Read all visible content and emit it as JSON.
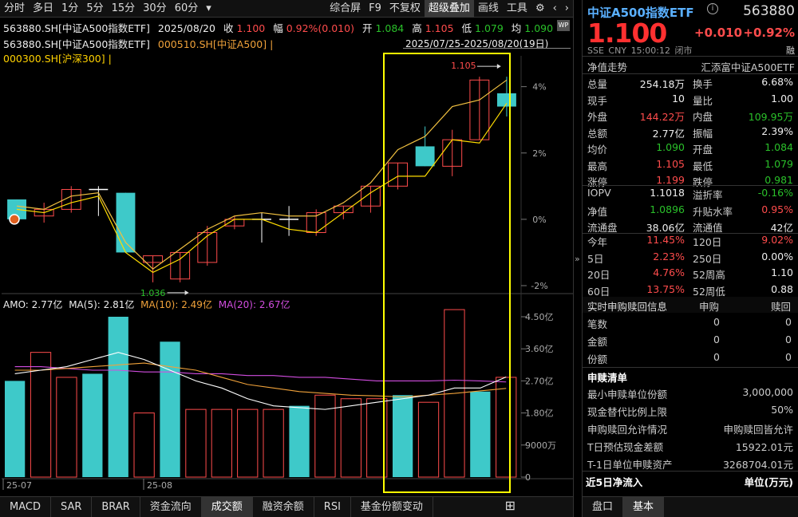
{
  "toolbar": {
    "left": [
      "分时",
      "多日",
      "1分",
      "5分",
      "15分",
      "30分",
      "60分",
      "▾"
    ],
    "right": [
      "综合屏",
      "F9",
      "不复权",
      "超级叠加",
      "画线",
      "工具"
    ],
    "active": "超级叠加"
  },
  "info1": {
    "code": "563880.SH[中证A500指数ETF]",
    "date": "2025/08/20",
    "close_label": "收",
    "close": "1.100",
    "chg_label": "幅",
    "chg": "0.92%(0.010)",
    "open_label": "开",
    "open": "1.084",
    "high_label": "高",
    "high": "1.105",
    "low_label": "低",
    "low": "1.079",
    "avg_label": "均",
    "avg": "1.090",
    "badge": "WP"
  },
  "info2": {
    "main": "563880.SH[中证A500指数ETF]",
    "overlay1": "000510.SH[中证A500]",
    "range": "2025/07/25-2025/08/20(19日)"
  },
  "info3": {
    "overlay2": "000300.SH[沪深300]"
  },
  "price_axis": [
    "4%",
    "2%",
    "0%",
    "-2%"
  ],
  "annotations": {
    "high": "1.105",
    "low": "1.036"
  },
  "vol_info": {
    "amo": "AMO: 2.77亿",
    "ma5": "MA(5): 2.81亿",
    "ma10": "MA(10): 2.49亿",
    "ma20": "MA(20): 2.67亿"
  },
  "vol_axis": [
    "4.50亿",
    "3.60亿",
    "2.70亿",
    "1.80亿",
    "9000万",
    "0"
  ],
  "date_axis": [
    "25-07",
    "25-08"
  ],
  "bottom_tabs": [
    "MACD",
    "SAR",
    "BRAR",
    "资金流向",
    "成交额",
    "融资余额",
    "RSI",
    "基金份额变动"
  ],
  "bottom_active": "成交额",
  "chart_data": {
    "type": "candlestick",
    "days": 19,
    "close_pct": [
      0.0,
      0.3,
      0.6,
      0.3,
      -1.2,
      -1.7,
      -1.3,
      -0.6,
      0.0,
      0.1,
      0.0,
      -0.3,
      0.3,
      0.8,
      1.6,
      2.1,
      3.4,
      3.6,
      3.6
    ],
    "ohlc_pct": [
      [
        0.6,
        0.6,
        0.0,
        0.0
      ],
      [
        0.1,
        0.5,
        -0.1,
        0.3
      ],
      [
        0.3,
        1.0,
        0.2,
        0.9
      ],
      [
        0.9,
        1.0,
        0.1,
        0.9
      ],
      [
        0.8,
        0.8,
        -1.0,
        -1.0
      ],
      [
        -1.3,
        -1.1,
        -1.9,
        -1.1
      ],
      [
        -1.8,
        -1.0,
        -1.9,
        -1.0
      ],
      [
        -1.3,
        -0.2,
        -1.4,
        -0.4
      ],
      [
        -0.2,
        0.1,
        -0.3,
        0.0
      ],
      [
        0.0,
        0.2,
        -0.7,
        0.0
      ],
      [
        0.0,
        0.4,
        -0.5,
        0.0
      ],
      [
        -0.4,
        0.3,
        -0.5,
        0.2
      ],
      [
        0.2,
        0.4,
        0.0,
        0.4
      ],
      [
        0.4,
        1.0,
        0.2,
        1.0
      ],
      [
        1.0,
        1.7,
        0.9,
        1.7
      ],
      [
        2.2,
        2.8,
        1.6,
        1.6
      ],
      [
        1.6,
        2.7,
        1.3,
        2.4
      ],
      [
        2.4,
        4.3,
        2.4,
        4.2
      ],
      [
        3.8,
        4.3,
        3.1,
        3.4
      ]
    ],
    "ohlc_overlay_extra": [
      [
        4.2,
        4.4,
        2.8,
        2.9
      ]
    ],
    "line_index_a500": [
      0.4,
      0.3,
      0.7,
      0.8,
      -0.7,
      -1.5,
      -0.9,
      -0.3,
      0.1,
      0.2,
      0.1,
      0.1,
      0.5,
      1.1,
      2.1,
      2.5,
      3.4,
      3.6,
      4.2
    ],
    "line_hs300": [
      0.3,
      0.2,
      0.5,
      0.7,
      -1.0,
      -1.6,
      -1.2,
      -0.5,
      0.0,
      0.0,
      -0.3,
      -0.4,
      0.2,
      0.8,
      1.3,
      1.3,
      2.4,
      2.3,
      3.5
    ],
    "volume_yi": [
      2.7,
      3.5,
      2.8,
      2.9,
      4.5,
      1.8,
      3.8,
      1.9,
      1.9,
      1.9,
      1.9,
      2.0,
      2.3,
      2.2,
      2.2,
      2.3,
      2.1,
      4.7,
      2.4,
      2.8
    ],
    "volume_up": [
      false,
      true,
      true,
      false,
      false,
      true,
      false,
      true,
      true,
      true,
      true,
      false,
      true,
      true,
      true,
      false,
      true,
      true,
      false,
      true
    ],
    "ma5_yi": [
      2.9,
      3.0,
      3.1,
      3.3,
      3.5,
      3.3,
      3.0,
      2.7,
      2.5,
      2.2,
      2.0,
      1.95,
      1.9,
      2.0,
      2.1,
      2.2,
      2.3,
      2.5,
      2.5,
      2.81
    ],
    "ma10_yi": [
      3.0,
      3.0,
      3.05,
      3.1,
      3.15,
      3.2,
      3.1,
      3.0,
      2.8,
      2.6,
      2.5,
      2.4,
      2.35,
      2.3,
      2.28,
      2.25,
      2.3,
      2.35,
      2.42,
      2.49
    ],
    "ma20_yi": [
      3.1,
      3.1,
      3.05,
      3.0,
      3.0,
      2.95,
      2.95,
      2.9,
      2.9,
      2.85,
      2.85,
      2.8,
      2.8,
      2.75,
      2.7,
      2.7,
      2.7,
      2.72,
      2.7,
      2.67
    ],
    "ylim_pct": [
      -2.0,
      4.4
    ],
    "vol_ylim": [
      0,
      4.5
    ]
  },
  "quote": {
    "name": "中证A500指数ETF",
    "code": "563880",
    "price": "1.100",
    "change": "+0.010",
    "change_pct": "+0.92%",
    "meta": [
      "SSE",
      "CNY",
      "15:00:12",
      "闭市"
    ],
    "tag": "融"
  },
  "nav_row": {
    "left": "净值走势",
    "right": "汇添富中证A500ETF"
  },
  "stats": [
    {
      "k1": "总量",
      "v1": "254.18万",
      "c1": "white",
      "k2": "换手",
      "v2": "6.68%",
      "c2": "white"
    },
    {
      "k1": "现手",
      "v1": "10",
      "c1": "white",
      "k2": "量比",
      "v2": "1.00",
      "c2": "white"
    },
    {
      "k1": "外盘",
      "v1": "144.22万",
      "c1": "red",
      "k2": "内盘",
      "v2": "109.95万",
      "c2": "green"
    },
    {
      "k1": "总额",
      "v1": "2.77亿",
      "c1": "white",
      "k2": "振幅",
      "v2": "2.39%",
      "c2": "white"
    },
    {
      "k1": "均价",
      "v1": "1.090",
      "c1": "green",
      "k2": "开盘",
      "v2": "1.084",
      "c2": "green"
    },
    {
      "k1": "最高",
      "v1": "1.105",
      "c1": "red",
      "k2": "最低",
      "v2": "1.079",
      "c2": "green"
    },
    {
      "k1": "涨停",
      "v1": "1.199",
      "c1": "red",
      "k2": "跌停",
      "v2": "0.981",
      "c2": "green"
    }
  ],
  "stats2": [
    {
      "k1": "IOPV",
      "v1": "1.1018",
      "c1": "white",
      "k2": "溢折率",
      "v2": "-0.16%",
      "c2": "green"
    },
    {
      "k1": "净值",
      "v1": "1.0896",
      "c1": "green",
      "k2": "升贴水率",
      "v2": "0.95%",
      "c2": "red"
    },
    {
      "k1": "流通盘",
      "v1": "38.06亿",
      "c1": "white",
      "k2": "流通值",
      "v2": "42亿",
      "c2": "white"
    }
  ],
  "stats3": [
    {
      "k1": "今年",
      "v1": "11.45%",
      "c1": "red",
      "k2": "120日",
      "v2": "9.02%",
      "c2": "red"
    },
    {
      "k1": "5日",
      "v1": "2.23%",
      "c1": "red",
      "k2": "250日",
      "v2": "0.00%",
      "c2": "white"
    },
    {
      "k1": "20日",
      "v1": "4.76%",
      "c1": "red",
      "k2": "52周高",
      "v2": "1.10",
      "c2": "white"
    },
    {
      "k1": "60日",
      "v1": "13.75%",
      "c1": "red",
      "k2": "52周低",
      "v2": "0.88",
      "c2": "white"
    }
  ],
  "realtime": {
    "header": [
      "实时申购赎回信息",
      "申购",
      "赎回"
    ],
    "rows": [
      {
        "k": "笔数",
        "a": "0",
        "b": "0"
      },
      {
        "k": "金额",
        "a": "0",
        "b": "0"
      },
      {
        "k": "份额",
        "a": "0",
        "b": "0"
      }
    ]
  },
  "purchase_list": {
    "title": "申赎清单",
    "rows": [
      {
        "k": "最小申赎单位份额",
        "v": "3,000,000"
      },
      {
        "k": "现金替代比例上限",
        "v": "50%"
      },
      {
        "k": "申购赎回允许情况",
        "v": "申购赎回皆允许"
      },
      {
        "k": "T日预估现金差额",
        "v": "15922.01元"
      },
      {
        "k": "T-1日单位申赎资产",
        "v": "3268704.01元"
      }
    ]
  },
  "inflow": {
    "left": "近5日净流入",
    "right": "单位(万元)"
  },
  "right_tabs": [
    "盘口",
    "基本"
  ],
  "right_tab_active": "基本",
  "colors": {
    "up": "#ff4c4c",
    "down": "#2ac02a",
    "cyan": "#3ec9c9",
    "highlight": "#ffff00",
    "line_a500": "#f0c040",
    "line_hs300": "#ffdd00"
  }
}
